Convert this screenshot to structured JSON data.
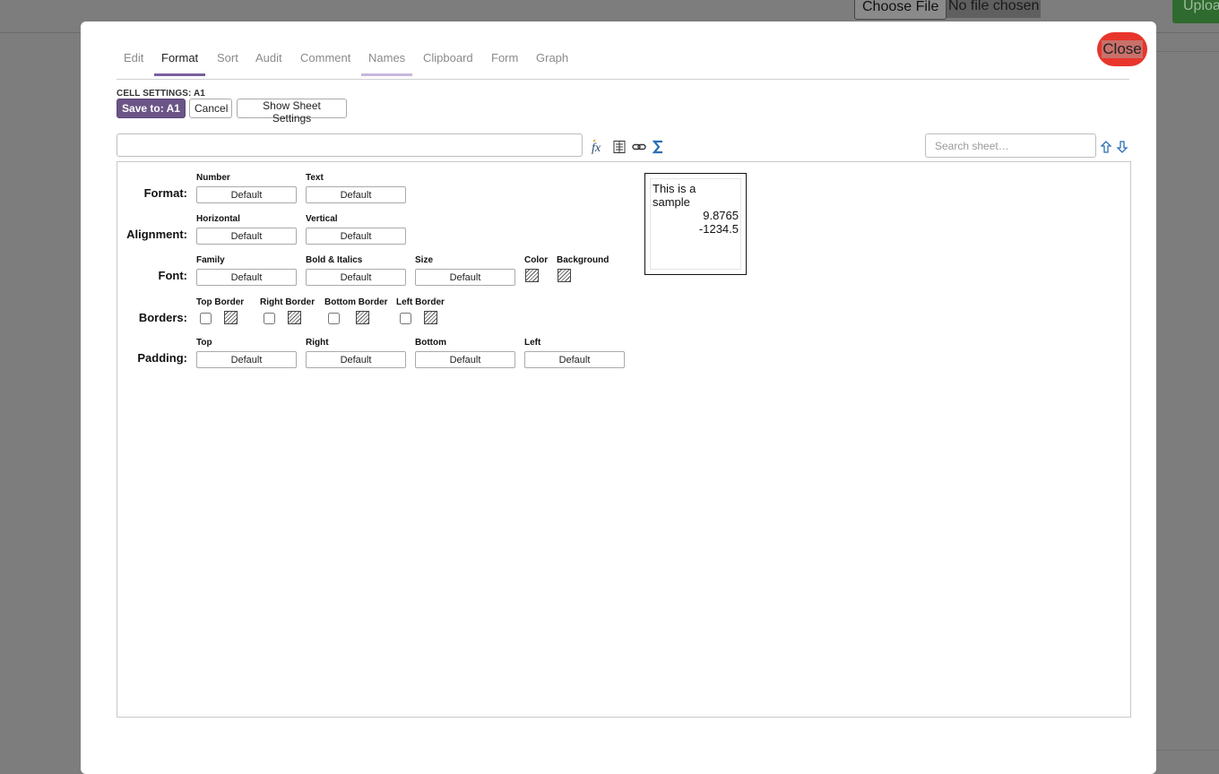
{
  "background": {
    "choose_file": "Choose File",
    "no_file": "No file chosen",
    "upload": "Uploa"
  },
  "modal": {
    "close_label": "Close",
    "tabs": [
      {
        "label": "Edit"
      },
      {
        "label": "Format"
      },
      {
        "label": "Sort"
      },
      {
        "label": "Audit"
      },
      {
        "label": "Comment"
      },
      {
        "label": "Names"
      },
      {
        "label": "Clipboard"
      },
      {
        "label": "Form"
      },
      {
        "label": "Graph"
      }
    ],
    "active_tab": "Format",
    "hovered_tab": "Names",
    "cell_settings": "CELL SETTINGS: A1",
    "buttons": {
      "save": "Save to: A1",
      "cancel": "Cancel",
      "show_sheet": "Show Sheet Settings"
    },
    "toolbar": {
      "formula_value": "",
      "icons": [
        "function-icon",
        "range-list-icon",
        "link-icon",
        "sum-icon"
      ],
      "search_placeholder": "Search sheet…",
      "nav_icons": [
        "arrow-up-icon",
        "arrow-down-icon"
      ]
    }
  },
  "format_panel": {
    "format": {
      "label": "Format:",
      "number_label": "Number",
      "number_value": "Default",
      "text_label": "Text",
      "text_value": "Default"
    },
    "alignment": {
      "label": "Alignment:",
      "horizontal_label": "Horizontal",
      "horizontal_value": "Default",
      "vertical_label": "Vertical",
      "vertical_value": "Default"
    },
    "font": {
      "label": "Font:",
      "family_label": "Family",
      "family_value": "Default",
      "bold_label": "Bold & Italics",
      "bold_value": "Default",
      "size_label": "Size",
      "size_value": "Default",
      "color_label": "Color",
      "background_label": "Background"
    },
    "borders": {
      "label": "Borders:",
      "top_label": "Top Border",
      "top_checked": false,
      "right_label": "Right Border",
      "right_checked": false,
      "bottom_label": "Bottom Border",
      "bottom_checked": false,
      "left_label": "Left Border",
      "left_checked": false
    },
    "padding": {
      "label": "Padding:",
      "top_label": "Top",
      "top_value": "Default",
      "right_label": "Right",
      "right_value": "Default",
      "bottom_label": "Bottom",
      "bottom_value": "Default",
      "left_label": "Left",
      "left_value": "Default"
    },
    "sample": {
      "text": "This is a sample",
      "num1": "9.8765",
      "num2": "-1234.5"
    }
  },
  "colors": {
    "accent": "#6b5587",
    "close": "#e8352c",
    "tab_active_underline": "#7a5fa0",
    "icon_blue": "#2a6fb5"
  }
}
